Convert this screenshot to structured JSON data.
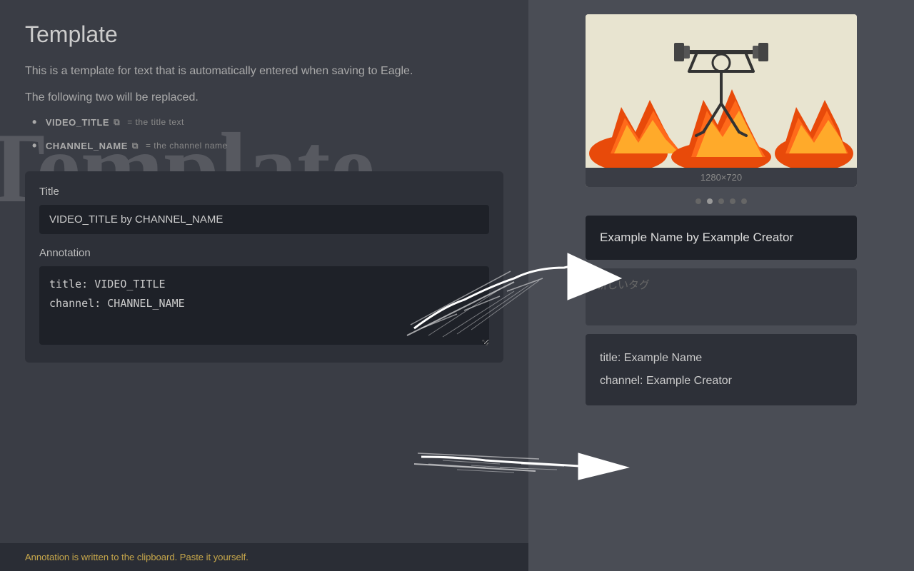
{
  "page": {
    "title": "Template",
    "description": "This is a template for text that is automatically entered when saving to Eagle.",
    "following_text": "The following two will be replaced.",
    "bullets": [
      {
        "key": "VIDEO_TITLE",
        "equals": "= the title text"
      },
      {
        "key": "CHANNEL_NAME",
        "equals": "= the channel name"
      }
    ]
  },
  "form": {
    "title_label": "Title",
    "title_value": "VIDEO_TITLE by CHANNEL_NAME",
    "annotation_label": "Annotation",
    "annotation_value": "title: VIDEO_TITLE\nchannel: CHANNEL_NAME"
  },
  "bottom_note": "Annotation is written to the clipboard. Paste it yourself.",
  "image": {
    "size_label": "1280×720"
  },
  "dots": [
    "inactive",
    "active",
    "inactive",
    "inactive",
    "inactive"
  ],
  "result_title": {
    "text": "Example Name by Example Creator"
  },
  "tag_placeholder": "新しいタグ",
  "result_annotation": {
    "line1": "title: Example Name",
    "line2": "channel: Example Creator"
  },
  "watermark": "Template"
}
